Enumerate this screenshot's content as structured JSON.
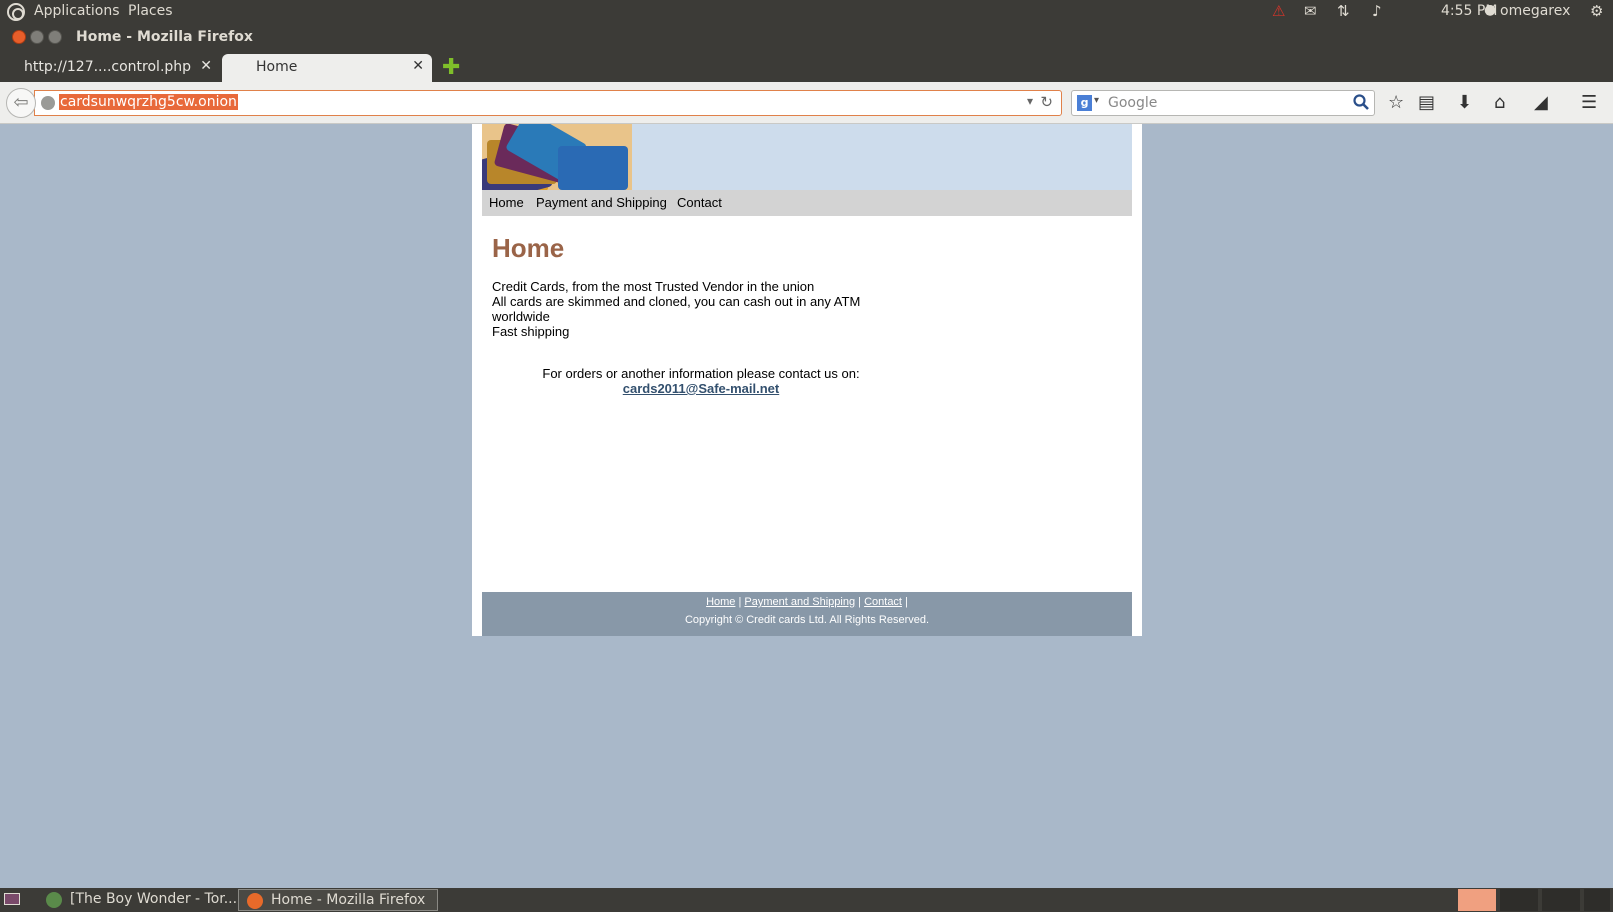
{
  "top_panel": {
    "menus": [
      "Applications",
      "Places"
    ],
    "clock": "4:55 PM",
    "user": "omegarex"
  },
  "window": {
    "title": "Home - Mozilla Firefox"
  },
  "tabs": [
    {
      "label": "http://127....control.php",
      "active": false
    },
    {
      "label": "Home",
      "active": true
    }
  ],
  "navbar": {
    "url": "cardsunwqrzhg5cw.onion",
    "search_placeholder": "Google"
  },
  "site": {
    "nav": [
      "Home",
      "Payment and Shipping",
      "Contact"
    ],
    "heading": "Home",
    "body_lines": [
      "Credit Cards, from the most Trusted Vendor in the union",
      "All cards are skimmed and cloned, you can cash out in any ATM",
      "worldwide",
      "Fast shipping"
    ],
    "contact_text": "For orders or another information please contact us on:",
    "email": "cards2011@Safe-mail.net",
    "footer_links": [
      "Home",
      "Payment and Shipping",
      "Contact"
    ],
    "copyright": "Copyright © Credit cards Ltd. All Rights Reserved."
  },
  "taskbar": {
    "tasks": [
      {
        "label": "[The Boy Wonder - Tor..."
      },
      {
        "label": "Home - Mozilla Firefox"
      }
    ]
  },
  "colors": {
    "page_background": "#a9b8c9",
    "heading": "#9a6448",
    "header_band": "#cddcec",
    "footer_band": "#8898a8",
    "url_selection": "#e8693a"
  }
}
